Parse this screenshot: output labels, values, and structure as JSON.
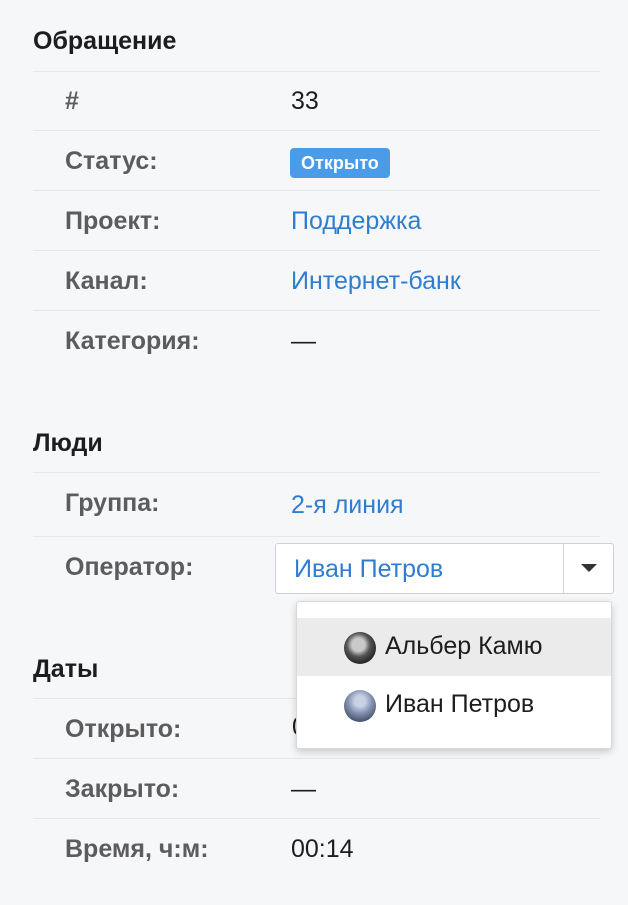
{
  "sections": {
    "ticket": {
      "title": "Обращение",
      "number_label": "#",
      "number_value": "33",
      "status_label": "Статус:",
      "status_value": "Открыто",
      "project_label": "Проект:",
      "project_value": "Поддержка",
      "channel_label": "Канал:",
      "channel_value": "Интернет-банк",
      "category_label": "Категория:",
      "category_value": "—"
    },
    "people": {
      "title": "Люди",
      "group_label": "Группа:",
      "group_value": "2-я линия",
      "operator_label": "Оператор:",
      "operator_value": "Иван Петров"
    },
    "dates": {
      "title": "Даты",
      "opened_label": "Открыто:",
      "opened_value_visible": "0",
      "closed_label": "Закрыто:",
      "closed_value": "—",
      "time_label": "Время, ч:м:",
      "time_value": "00:14"
    }
  },
  "dropdown": {
    "options": [
      {
        "label": "Альбер Камю",
        "avatar": "avatar-albert-kamyu",
        "highlighted": true
      },
      {
        "label": "Иван Петров",
        "avatar": "avatar-ivan-petrov",
        "highlighted": false
      }
    ]
  },
  "colors": {
    "link": "#2f7dd1",
    "badge": "#4a9be8",
    "background": "#f6f7f9"
  }
}
